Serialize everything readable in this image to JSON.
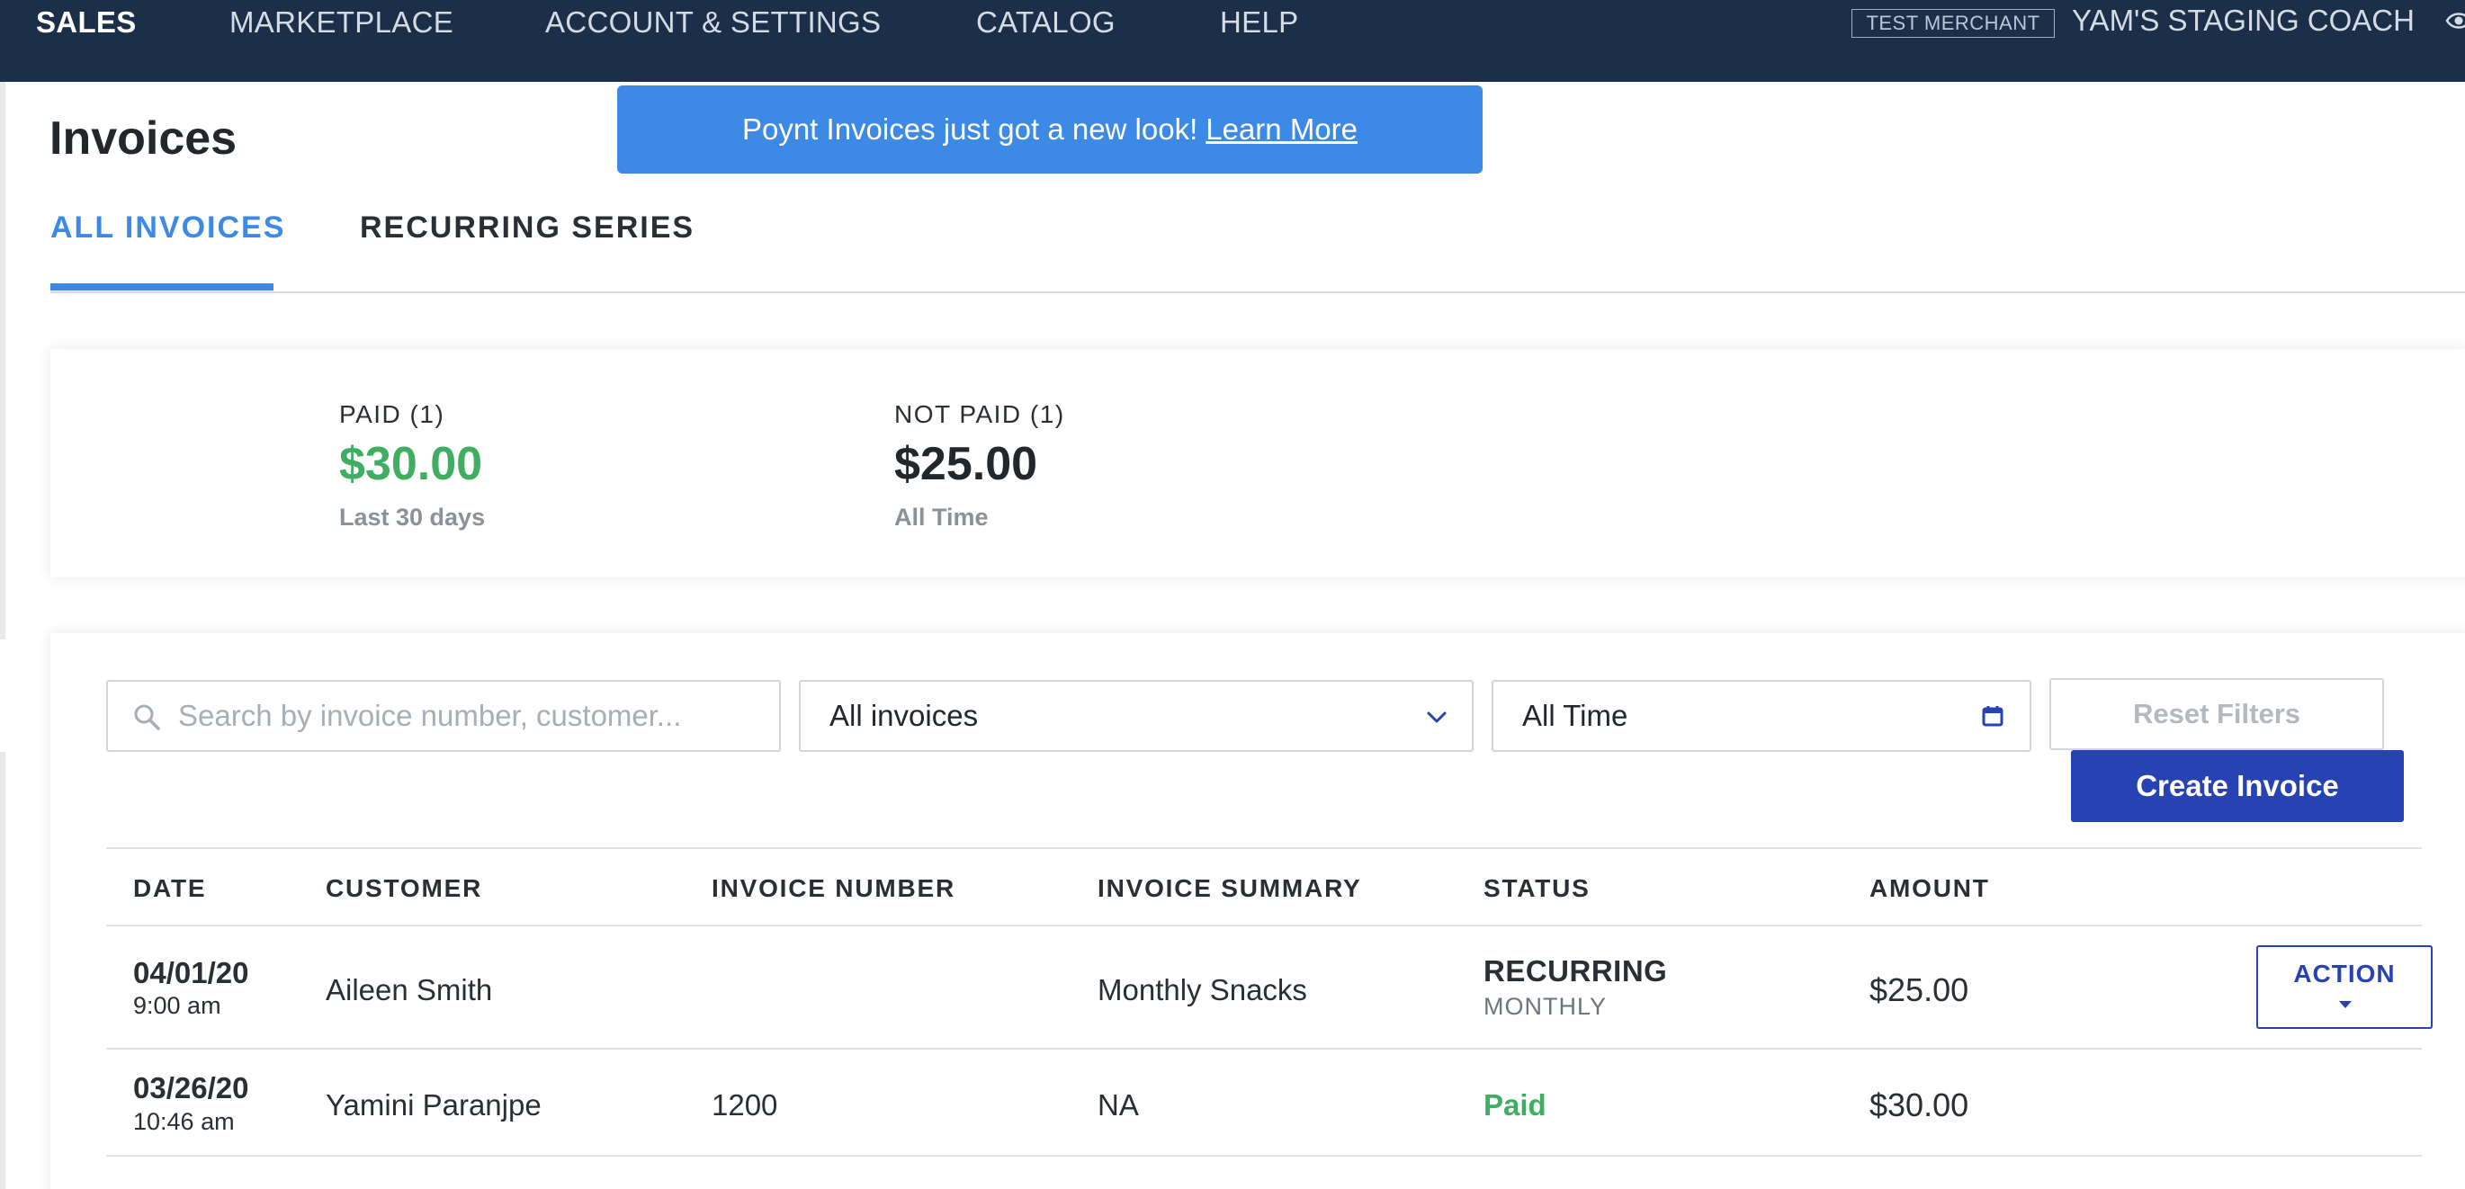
{
  "nav": {
    "items": [
      "SALES",
      "MARKETPLACE",
      "ACCOUNT & SETTINGS",
      "CATALOG",
      "HELP"
    ],
    "active": "SALES",
    "merchant_badge": "TEST MERCHANT",
    "merchant_name": "YAM'S STAGING COACH"
  },
  "page": {
    "title": "Invoices"
  },
  "banner": {
    "text": "Poynt Invoices just got a new look!",
    "link": "Learn More"
  },
  "tabs": [
    {
      "label": "ALL INVOICES",
      "active": true
    },
    {
      "label": "RECURRING SERIES",
      "active": false
    }
  ],
  "summary": {
    "paid": {
      "label": "PAID (1)",
      "amount": "$30.00",
      "period": "Last 30 days"
    },
    "not_paid": {
      "label": "NOT PAID (1)",
      "amount": "$25.00",
      "period": "All Time"
    }
  },
  "filters": {
    "search_placeholder": "Search by invoice number, customer...",
    "invoice_filter": "All invoices",
    "date_filter": "All Time",
    "reset_label": "Reset Filters"
  },
  "create_label": "Create Invoice",
  "table": {
    "columns": [
      "DATE",
      "CUSTOMER",
      "INVOICE NUMBER",
      "INVOICE SUMMARY",
      "STATUS",
      "AMOUNT"
    ],
    "rows": [
      {
        "date": "04/01/20",
        "time": "9:00 am",
        "customer": "Aileen Smith",
        "invoice_number": "",
        "summary": "Monthly Snacks",
        "status": "RECURRING",
        "status_sub": "MONTHLY",
        "amount": "$25.00",
        "action": "ACTION"
      },
      {
        "date": "03/26/20",
        "time": "10:46 am",
        "customer": "Yamini Paranjpe",
        "invoice_number": "1200",
        "summary": "NA",
        "status": "Paid",
        "status_sub": "",
        "amount": "$30.00",
        "action": ""
      }
    ]
  },
  "colors": {
    "nav_bg": "#1b3048",
    "accent_blue": "#3d8ae6",
    "primary_button": "#2743b3",
    "paid_green": "#3fae62"
  },
  "icons": {
    "search": "search-icon",
    "dropdown": "chevron-down-icon",
    "date": "calendar-icon",
    "action": "caret-down-icon",
    "visibility": "eye-icon"
  }
}
